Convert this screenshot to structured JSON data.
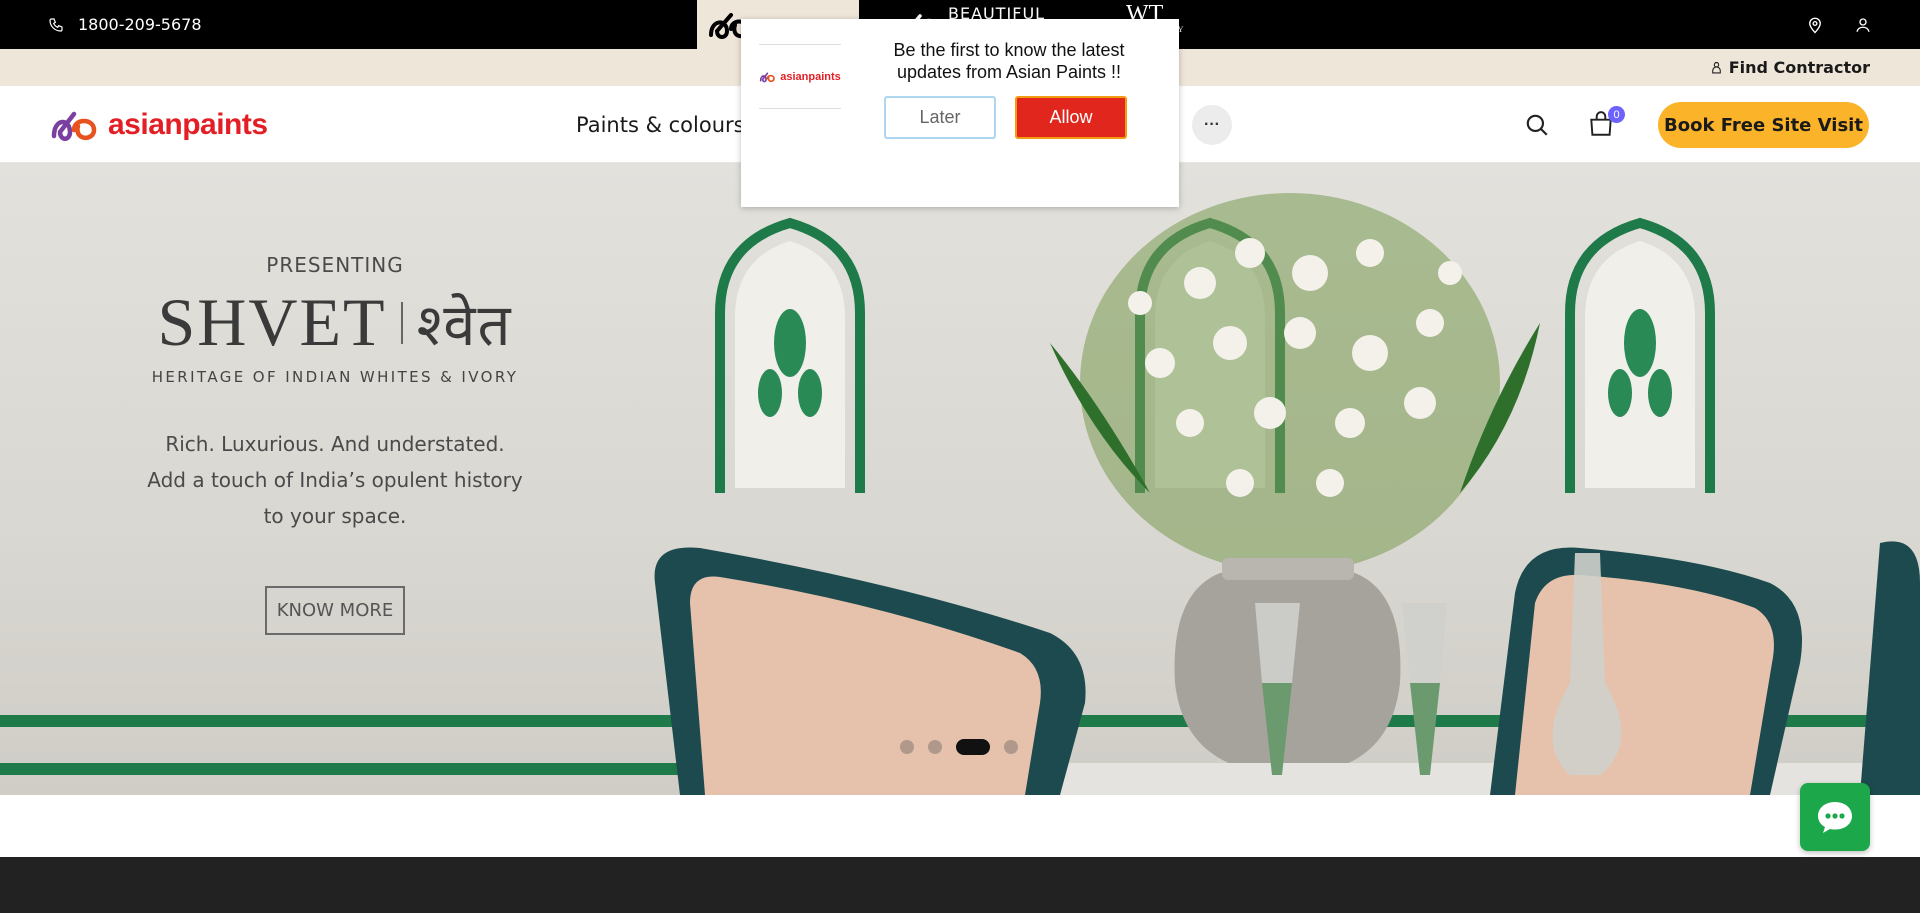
{
  "topbar": {
    "phone": "1800-209-5678",
    "brands": [
      {
        "name": "asianpaints",
        "active": true
      },
      {
        "name": "BEAUTIFUL HOMES",
        "visible_text": "BEAUTIFUL",
        "active": false
      },
      {
        "name": "WT",
        "visible_text": "WT",
        "suffix_text": "PANY",
        "active": false
      }
    ],
    "icons": [
      "location-pin-icon",
      "user-icon"
    ]
  },
  "subbar": {
    "find_contractor": "Find Contractor"
  },
  "nav": {
    "logo_text": "asianpaints",
    "menu": [
      {
        "label": "Paints & colours"
      }
    ],
    "more_label": "···",
    "cart_count": "0",
    "book_button": "Book Free Site Visit"
  },
  "hero": {
    "presenting": "PRESENTING",
    "title_latin": "SHVET",
    "title_devanagari": "श्वेत",
    "subtitle": "HERITAGE OF INDIAN WHITES & IVORY",
    "tagline": [
      "Rich. Luxurious. And understated.",
      "Add a touch of India’s opulent history",
      "to your space."
    ],
    "cta": "KNOW MORE",
    "carousel": {
      "total": 4,
      "active_index": 2
    }
  },
  "popup": {
    "logo_text": "asianpaints",
    "message": "Be the first to know the latest updates from Asian Paints !!",
    "later": "Later",
    "allow": "Allow"
  },
  "colors": {
    "brand_red": "#e31e24",
    "cta_yellow": "#fbb42a",
    "chat_green": "#1ca84a",
    "beige": "#eee6d8"
  }
}
